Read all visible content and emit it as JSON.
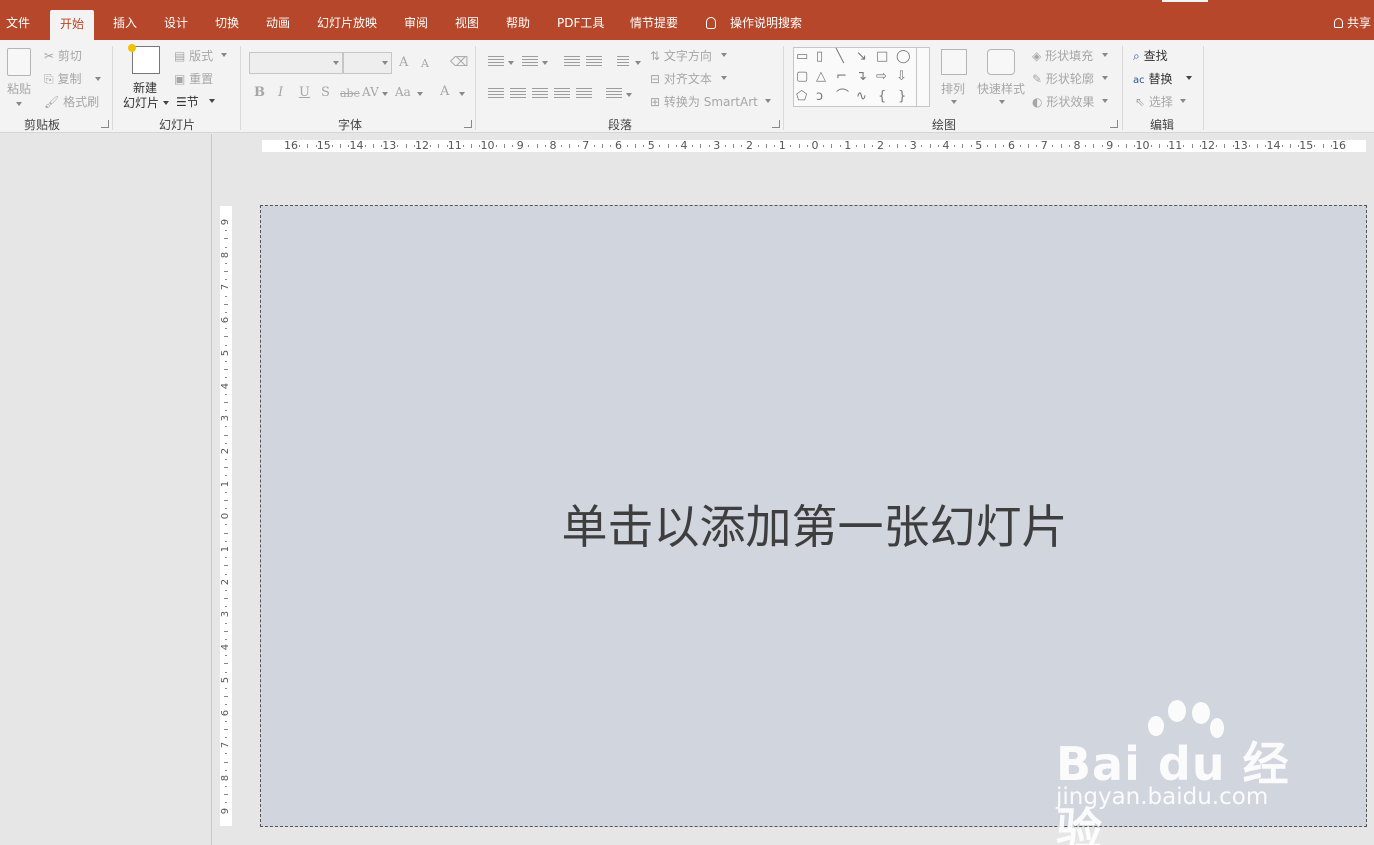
{
  "tabs": [
    {
      "label": "文件",
      "active": false
    },
    {
      "label": "开始",
      "active": true
    },
    {
      "label": "插入",
      "active": false
    },
    {
      "label": "设计",
      "active": false
    },
    {
      "label": "切换",
      "active": false
    },
    {
      "label": "动画",
      "active": false
    },
    {
      "label": "幻灯片放映",
      "active": false
    },
    {
      "label": "审阅",
      "active": false
    },
    {
      "label": "视图",
      "active": false
    },
    {
      "label": "帮助",
      "active": false
    },
    {
      "label": "PDF工具",
      "active": false
    },
    {
      "label": "情节提要",
      "active": false
    }
  ],
  "tell_me": "操作说明搜索",
  "share": "共享",
  "colors": {
    "accent": "#b7472a",
    "ribbon": "#f3f3f3",
    "slide_bg": "#d0d5de"
  },
  "ribbon": {
    "clipboard": {
      "label": "剪贴板",
      "paste": "粘贴",
      "cut": "剪切",
      "copy": "复制",
      "format_painter": "格式刷"
    },
    "slides": {
      "label": "幻灯片",
      "new_slide_1": "新建",
      "new_slide_2": "幻灯片",
      "layout": "版式",
      "reset": "重置",
      "section": "节"
    },
    "font": {
      "label": "字体",
      "bold": "B",
      "italic": "I",
      "underline": "U",
      "shadow": "S",
      "strike": "abc",
      "spacing": "AV",
      "case": "Aa",
      "grow": "A",
      "shrink": "A",
      "color": "A"
    },
    "paragraph": {
      "label": "段落",
      "text_direction": "文字方向",
      "align_text": "对齐文本",
      "smartart": "转换为 SmartArt"
    },
    "drawing": {
      "label": "绘图",
      "arrange": "排列",
      "quick_styles": "快速样式",
      "shape_fill": "形状填充",
      "shape_outline": "形状轮廓",
      "shape_effects": "形状效果"
    },
    "editing": {
      "label": "编辑",
      "find": "查找",
      "replace": "替换",
      "select": "选择"
    }
  },
  "hruler_marks": [
    "16",
    "15",
    "14",
    "13",
    "12",
    "11",
    "10",
    "9",
    "8",
    "7",
    "6",
    "5",
    "4",
    "3",
    "2",
    "1",
    "0",
    "1",
    "2",
    "3",
    "4",
    "5",
    "6",
    "7",
    "8",
    "9",
    "10",
    "11",
    "12",
    "13",
    "14",
    "15",
    "16"
  ],
  "vruler_marks": [
    "9",
    "8",
    "7",
    "6",
    "5",
    "4",
    "3",
    "2",
    "1",
    "0",
    "1",
    "2",
    "3",
    "4",
    "5",
    "6",
    "7",
    "8",
    "9"
  ],
  "slide": {
    "placeholder": "单击以添加第一张幻灯片"
  },
  "watermark": {
    "brand": "Bai du 经验",
    "url": "jingyan.baidu.com"
  }
}
